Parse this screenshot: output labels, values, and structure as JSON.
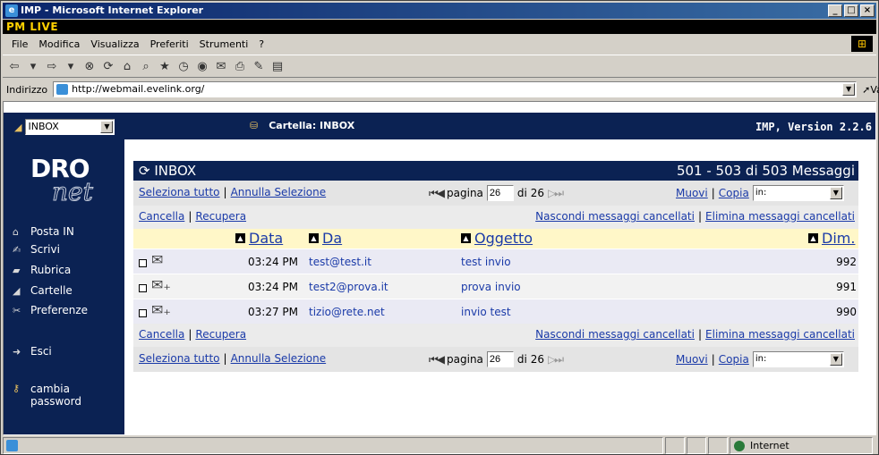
{
  "window": {
    "title": "IMP - Microsoft Internet Explorer"
  },
  "brand": "PM LIVE",
  "menu": [
    "File",
    "Modifica",
    "Visualizza",
    "Preferiti",
    "Strumenti",
    "?"
  ],
  "address": {
    "label": "Indirizzo",
    "url": "http://webmail.evelink.org/",
    "go": "Vai"
  },
  "header": {
    "folder_select": "INBOX",
    "folder_title": "Cartella: INBOX",
    "version": "IMP, Version 2.2.6"
  },
  "sidebar": {
    "logo_top": "DRO",
    "logo_bottom": "net",
    "items": [
      {
        "label": "Posta IN",
        "icon": "house-icon"
      },
      {
        "label": "Scrivi",
        "icon": "pen-icon"
      },
      {
        "label": "Rubrica",
        "icon": "book-icon"
      },
      {
        "label": "Cartelle",
        "icon": "folder-icon"
      },
      {
        "label": "Preferenze",
        "icon": "tools-icon"
      }
    ],
    "logout": "Esci",
    "change_password_1": "cambia",
    "change_password_2": "password"
  },
  "inbox": {
    "title": "INBOX",
    "count": "501 - 503 di 503 Messaggi"
  },
  "controls": {
    "select_all": "Seleziona tutto",
    "deselect": "Annulla Selezione",
    "page_label": "pagina",
    "page_value": "26",
    "page_total": "di 26",
    "move": "Muovi",
    "copy": "Copia",
    "target": "in:",
    "delete": "Cancella",
    "recover": "Recupera",
    "hide_deleted": "Nascondi messaggi cancellati",
    "purge_deleted": "Elimina messaggi cancellati"
  },
  "columns": {
    "date": "Data",
    "from": "Da",
    "subject": "Oggetto",
    "size": "Dim."
  },
  "messages": [
    {
      "time": "03:24 PM",
      "from": "test@test.it",
      "subject": "test invio",
      "size": "992"
    },
    {
      "time": "03:24 PM",
      "from": "test2@prova.it",
      "subject": "prova invio",
      "size": "991"
    },
    {
      "time": "03:27 PM",
      "from": "tizio@rete.net",
      "subject": "invio test",
      "size": "990"
    }
  ],
  "status": {
    "zone": "Internet"
  }
}
